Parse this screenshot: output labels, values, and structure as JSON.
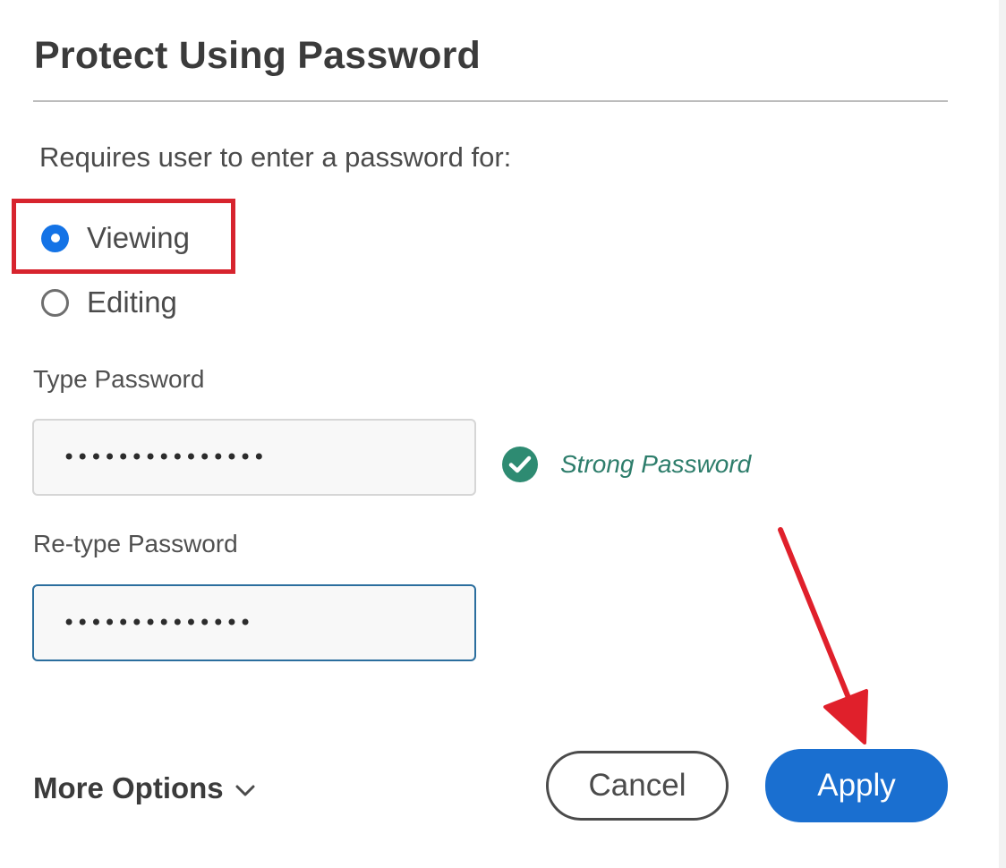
{
  "dialog": {
    "title": "Protect Using Password",
    "subtitle": "Requires user to enter a password for:"
  },
  "options": {
    "viewing_label": "Viewing",
    "editing_label": "Editing",
    "selected": "Viewing"
  },
  "password": {
    "type_label": "Type Password",
    "type_value": "•••••••••••••••",
    "retype_label": "Re-type Password",
    "retype_value": "••••••••••••••",
    "strength_text": "Strong Password"
  },
  "footer": {
    "more_options_label": "More Options",
    "cancel_label": "Cancel",
    "apply_label": "Apply"
  },
  "icons": {
    "strength": "check-circle-icon",
    "more_options": "chevron-down-icon"
  },
  "colors": {
    "accent": "#1473e6",
    "highlight": "#d7242e",
    "success": "#2d7d6b"
  }
}
